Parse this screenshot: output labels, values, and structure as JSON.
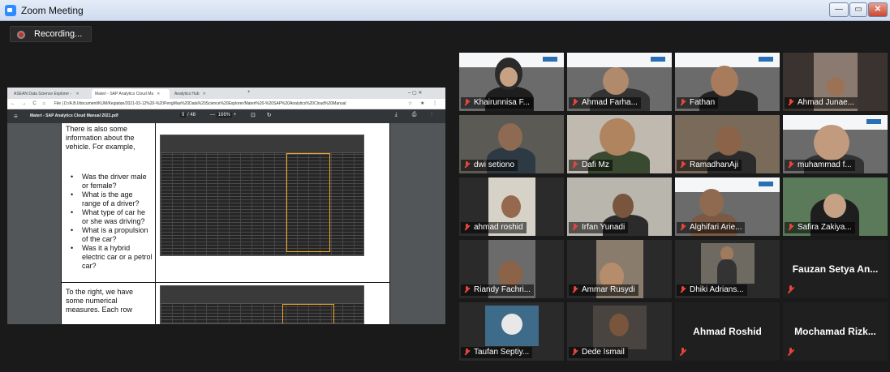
{
  "window": {
    "title": "Zoom Meeting",
    "minimize": "—",
    "maximize": "▭",
    "close": "✕"
  },
  "recording": {
    "label": "Recording..."
  },
  "browser": {
    "tabs": [
      {
        "label": "ASEAN Data Science Explorer - "
      },
      {
        "label": "Materi - SAP Analytics Cloud Ma"
      },
      {
        "label": "Analytics Hub"
      }
    ],
    "new_tab": "+",
    "window_controls": "–  ▢  ✕",
    "nav": "← → C ⌂",
    "url": "File | D:/A.B.I/document/KUM/Kegiatan/2021-03-12%20-%20PengMas%20Data%20Science%20Explorer/Materi%20-%20SAP%20Analytics%20Cloud%20Manual",
    "toolbar_icons": "☆ ★ ⋮"
  },
  "pdf": {
    "menu_icon": "≡",
    "filename": "Materi - SAP Analytics Cloud Manual 2021.pdf",
    "page": "9",
    "page_total": "/ 48",
    "zoom": "166%",
    "zoom_minus": "—",
    "zoom_plus": "+",
    "tools": "⊡ ↻",
    "right_icons": "⤓ ⎙ ⋮",
    "intro": "There is also some information about the vehicle. For example,",
    "bullets": [
      "Was the driver male or female?",
      "What is the age range of a driver?",
      "What type of car he or she was driving?",
      "What is a propulsion of the car?",
      "Was it a hybrid electric car or a petrol car?"
    ],
    "second": "To the right, we have some numerical measures. Each row"
  },
  "participants": [
    {
      "name": "Khairunnisa F...",
      "type": "video"
    },
    {
      "name": "Ahmad Farha...",
      "type": "video"
    },
    {
      "name": "Fathan",
      "type": "video"
    },
    {
      "name": "Ahmad Junae...",
      "type": "video"
    },
    {
      "name": "dwi setiono",
      "type": "video"
    },
    {
      "name": "Dafi Mz",
      "type": "video"
    },
    {
      "name": "RamadhanAji",
      "type": "video"
    },
    {
      "name": "muhammad f...",
      "type": "video"
    },
    {
      "name": "ahmad roshid",
      "type": "video"
    },
    {
      "name": "Irfan Yunadi",
      "type": "video"
    },
    {
      "name": "Alghifari Arie...",
      "type": "video"
    },
    {
      "name": "Safira Zakiya...",
      "type": "video"
    },
    {
      "name": "Riandy Fachri...",
      "type": "video"
    },
    {
      "name": "Ammar Rusydi",
      "type": "video"
    },
    {
      "name": "Dhiki Adrians...",
      "type": "video"
    },
    {
      "name": "Fauzan Setya An...",
      "type": "name"
    },
    {
      "name": "Taufan Septiy...",
      "type": "video"
    },
    {
      "name": "Dede Ismail",
      "type": "video"
    },
    {
      "name": "Ahmad Roshid",
      "type": "name"
    },
    {
      "name": "Mochamad Rizk...",
      "type": "name"
    }
  ],
  "colors": {
    "muted_mic": "#e8453c",
    "highlight": "#f4a823",
    "zoom_blue": "#2d8cff"
  }
}
